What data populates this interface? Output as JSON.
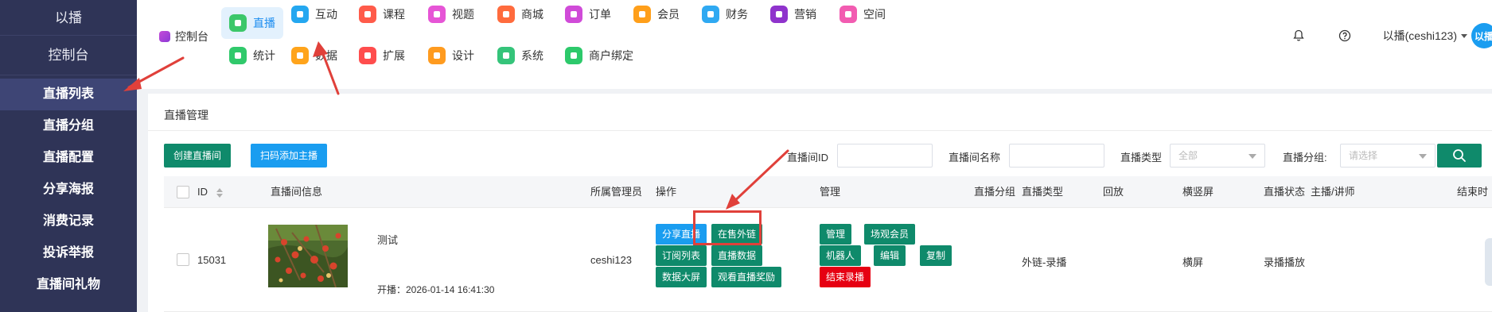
{
  "sidebar": {
    "brand": "以播",
    "console": "控制台",
    "items": [
      {
        "label": "直播列表",
        "active": true
      },
      {
        "label": "直播分组"
      },
      {
        "label": "直播配置"
      },
      {
        "label": "分享海报"
      },
      {
        "label": "消费记录"
      },
      {
        "label": "投诉举报"
      },
      {
        "label": "直播间礼物"
      }
    ]
  },
  "topnav": {
    "console_label": "控制台",
    "row1": [
      "直播",
      "互动",
      "课程",
      "视题",
      "商城",
      "订单",
      "会员",
      "财务",
      "营销",
      "空间"
    ],
    "row2": [
      "统计",
      "数据",
      "扩展",
      "设计",
      "系统",
      "商户绑定"
    ],
    "active": "直播",
    "user": "以播(ceshi123)",
    "avatar_text": "以播",
    "icon_colors": {
      "直播": "#3cc76a",
      "互动": "#24a7f0",
      "课程": "#ff5b4a",
      "视题": "#e655d6",
      "商城": "#ff6b3d",
      "订单": "#d04bd8",
      "会员": "#ff9f1a",
      "财务": "#2fa9f2",
      "营销": "#8f33cc",
      "空间": "#f25cb1",
      "统计": "#30c96b",
      "数据": "#ffa41b",
      "扩展": "#ff4d4d",
      "设计": "#ff9b1f",
      "系统": "#35c47a",
      "商户绑定": "#2dc96b"
    }
  },
  "main": {
    "title": "直播管理",
    "buttons": {
      "create": "创建直播间",
      "scan": "扫码添加主播"
    },
    "filters": {
      "room_id_label": "直播间ID",
      "room_name_label": "直播间名称",
      "type_label": "直播类型",
      "type_value": "全部",
      "group_label": "直播分组:",
      "group_placeholder": "请选择"
    },
    "table": {
      "headers": [
        "ID",
        "直播间信息",
        "所属管理员",
        "操作",
        "管理",
        "直播分组",
        "直播类型",
        "回放",
        "横竖屏",
        "直播状态",
        "主播/讲师",
        "结束时"
      ],
      "rows": [
        {
          "id": "15031",
          "name": "测试",
          "start": "开播：2026-01-14 16:41:30",
          "admin": "ceshi123",
          "ops": [
            "分享直播",
            "在售外链",
            "订阅列表",
            "直播数据",
            "数据大屏",
            "观看直播奖励"
          ],
          "manage": [
            "管理",
            "场观会员",
            "机器人",
            "编辑",
            "复制",
            "结束录播"
          ],
          "group": "",
          "type": "外链-录播",
          "replay": "",
          "orientation": "横屏",
          "status": "录播播放",
          "host": ""
        }
      ]
    }
  }
}
